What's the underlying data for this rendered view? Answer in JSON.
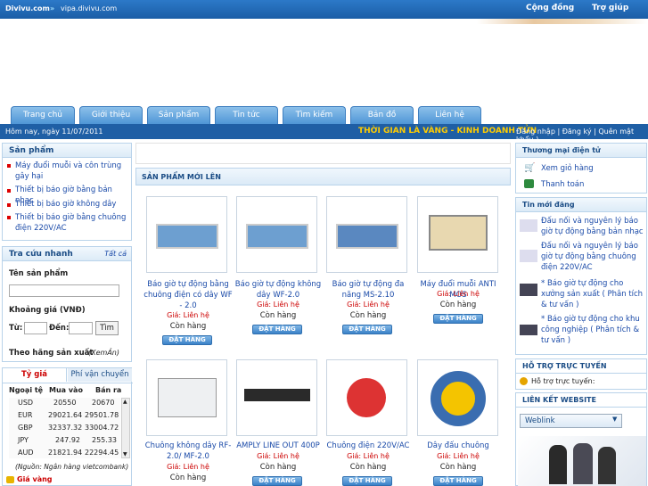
{
  "topbar": {
    "brand": "Divivu.com",
    "sep": "»",
    "sub": "vipa.divivu.com",
    "community": "Cộng đồng",
    "help": "Trợ giúp"
  },
  "nav": {
    "tabs": [
      "Trang chủ",
      "Giới thiệu",
      "Sản phẩm",
      "Tin tức",
      "Tìm kiếm",
      "Bản đồ",
      "Liên hệ"
    ]
  },
  "bar": {
    "date": "Hôm nay, ngày 11/07/2011",
    "slogan": "THỜI GIAN LÀ VÀNG - KINH DOANH TỬN",
    "links": "Đăng nhập | Đăng ký | Quên mật khẩu )"
  },
  "sidebar": {
    "products_title": "Sản phẩm",
    "products": [
      "Máy đuổi muỗi và côn trùng gây hại",
      "Thiết bị báo giờ bằng bản nhạc",
      "Thiết bị báo giờ không dây",
      "Thiết bị báo giờ bằng chuông điện 220V/AC"
    ],
    "search_title": "Tra cứu nhanh",
    "search_all": "Tất cả",
    "name_label": "Tên sản phẩm",
    "price_label": "Khoảng giá (VNĐ)",
    "from_label": "Từ:",
    "to_label": "Đến:",
    "search_btn": "Tìm",
    "maker_label": "Theo hãng sản xuất",
    "maker_all": "(XemẢn)",
    "rate_tab": "Tỷ giá",
    "ship_tab": "Phí vận chuyển",
    "rate_headers": [
      "Ngoại tệ",
      "Mua vào",
      "Bán ra"
    ],
    "rates": [
      [
        "USD",
        "20550",
        "20670"
      ],
      [
        "EUR",
        "29021.64",
        "29501.78"
      ],
      [
        "GBP",
        "32337.32",
        "33004.72"
      ],
      [
        "JPY",
        "247.92",
        "255.33"
      ],
      [
        "AUD",
        "21821.94",
        "22294.45"
      ]
    ],
    "rate_source": "(Nguồn: Ngân hàng vietcombank)",
    "gold": "Giá vàng"
  },
  "center": {
    "title": "SẢN PHẨM MỚI LÊN",
    "order_label": "ĐẶT HÀNG",
    "products": [
      {
        "name": "Báo giờ tự động bằng chuông điện có dây WF - 2.0",
        "price": "Giá: Liên hệ",
        "stock": "Còn hàng"
      },
      {
        "name": "Báo giờ tự động không dây WF-2.0",
        "price": "Giá: Liên hệ",
        "stock": "Còn hàng"
      },
      {
        "name": "Báo giờ tự động đa năng MS-2.10",
        "price": "Giá: Liên hệ",
        "stock": "Còn hàng"
      },
      {
        "name": "Máy đuổi muỗi ANTI MOS",
        "price": "Giá: Liên hệ",
        "stock": "Còn hàng"
      },
      {
        "name": "Chuông không dây RF-2.0/ MF-2.0",
        "price": "Giá: Liên hệ",
        "stock": "Còn hàng"
      },
      {
        "name": "AMPLY LINE OUT 400P",
        "price": "Giá: Liên hệ",
        "stock": "Còn hàng"
      },
      {
        "name": "Chuông điện 220V/AC",
        "price": "Giá: Liên hệ",
        "stock": "Còn hàng"
      },
      {
        "name": "Dây đấu chuông",
        "price": "Giá: Liên hệ",
        "stock": "Còn hàng"
      }
    ]
  },
  "right": {
    "shop_title": "Thương mại điện tử",
    "cart": "Xem giỏ hàng",
    "pay": "Thanh toán",
    "news_title": "Tin mới đăng",
    "news": [
      "Đấu nối và nguyên lý báo giờ tự động bằng bản nhạc",
      "Đấu nối và nguyên lý báo giờ tự động bằng chuông điện 220V/AC",
      "* Báo giờ tự động cho xưởng sản xuất ( Phân tích & tư vấn )",
      "* Báo giờ tự động cho khu công nghiệp ( Phân tích & tư vấn )"
    ],
    "support_title": "HỖ TRỢ TRỰC TUYẾN",
    "support_text": "Hỗ trợ trực tuyến:",
    "links_title": "LIÊN KẾT WEBSITE",
    "weblink": "Weblink"
  },
  "colors": {
    "primary": "#1f5fa5",
    "accent": "#ffcc00",
    "price": "#cc0000"
  }
}
